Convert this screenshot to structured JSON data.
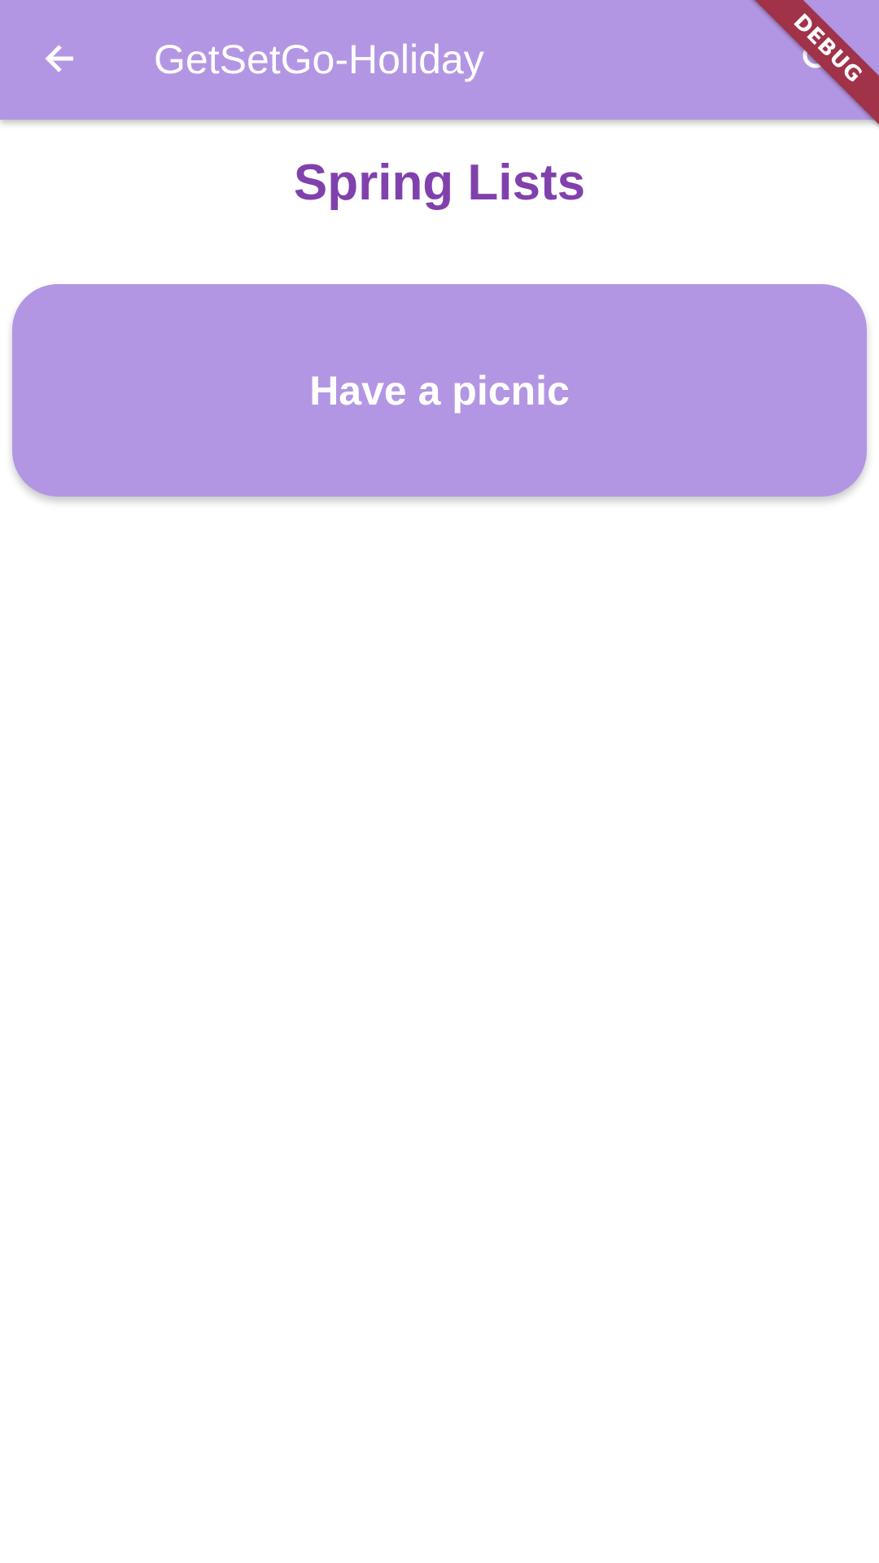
{
  "app_bar": {
    "title": "GetSetGo-Holiday",
    "back_icon": "arrow-back-icon",
    "search_icon": "search-icon",
    "background_color": "#b396e3",
    "text_color": "#ffffff"
  },
  "debug_banner": {
    "label": "DEBUG",
    "color": "#a0324a"
  },
  "page": {
    "heading": "Spring Lists",
    "heading_color": "#8141ad"
  },
  "lists": [
    {
      "label": "Have a picnic"
    }
  ]
}
